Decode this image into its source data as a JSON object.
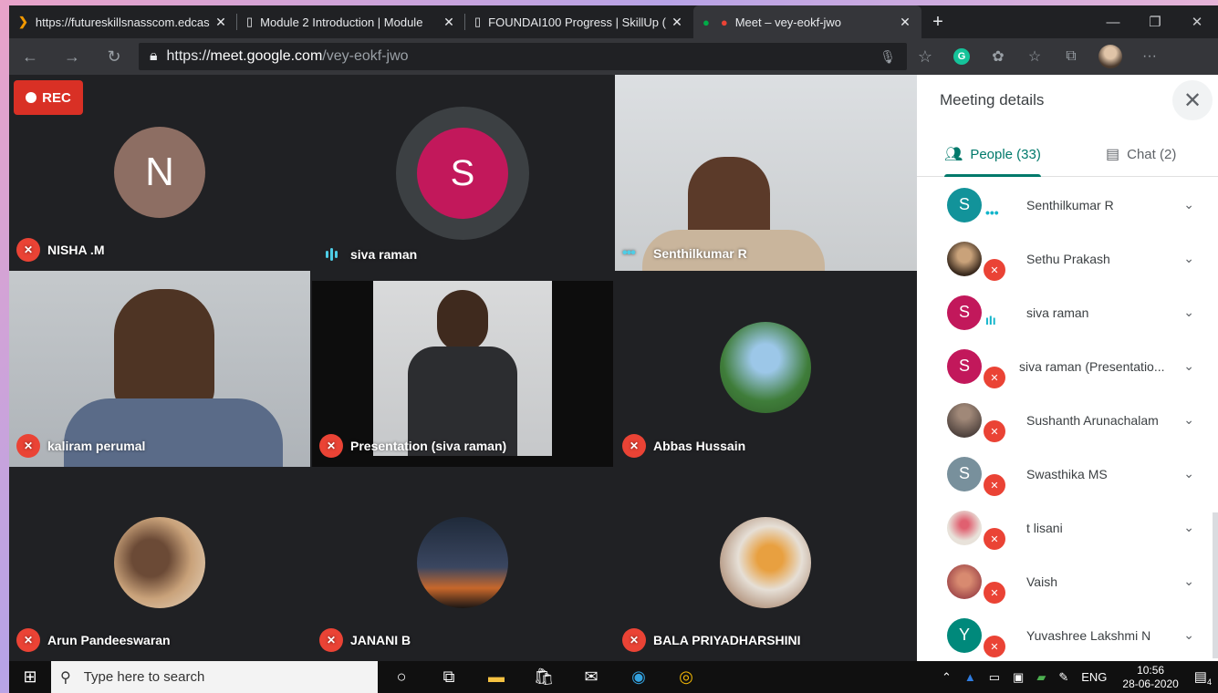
{
  "browser": {
    "tabs": [
      {
        "title": "https://futureskillsnasscom.edcas",
        "icon": "chevron-right-icon"
      },
      {
        "title": "Module 2 Introduction | Module",
        "icon": "page-icon"
      },
      {
        "title": "FOUNDAI100 Progress | SkillUp (",
        "icon": "page-icon"
      },
      {
        "title": "Meet – vey-eokf-jwo",
        "icon": "meet-icon"
      }
    ],
    "url_scheme": "https://",
    "url_host": "meet.google.com",
    "url_path": "/vey-eokf-jwo"
  },
  "meet": {
    "rec_label": "REC",
    "tiles": [
      {
        "name": "NISHA .M",
        "initial": "N",
        "status": "muted"
      },
      {
        "name": "siva raman",
        "initial": "S",
        "status": "talking"
      },
      {
        "name": "Senthilkumar R",
        "initial": "",
        "status": "dots"
      },
      {
        "name": "kaliram perumal",
        "initial": "",
        "status": "muted"
      },
      {
        "name": "Presentation (siva raman)",
        "initial": "",
        "status": "muted"
      },
      {
        "name": "Abbas Hussain",
        "initial": "",
        "status": "muted"
      },
      {
        "name": "Arun Pandeeswaran",
        "initial": "",
        "status": "muted"
      },
      {
        "name": "JANANI B",
        "initial": "",
        "status": "muted"
      },
      {
        "name": "BALA PRIYADHARSHINI",
        "initial": "",
        "status": "muted"
      }
    ]
  },
  "panel": {
    "title": "Meeting details",
    "people_tab": "People (33)",
    "chat_tab": "Chat (2)",
    "people": [
      {
        "name": "Senthilkumar R",
        "initial": "S",
        "color": "#12939a",
        "status": "dots"
      },
      {
        "name": "Sethu Prakash",
        "initial": "",
        "color": "#5a4a3a",
        "status": "muted"
      },
      {
        "name": "siva raman",
        "initial": "S",
        "color": "#c2185b",
        "status": "talking"
      },
      {
        "name": "siva raman (Presentatio...",
        "initial": "S",
        "color": "#c2185b",
        "status": "muted"
      },
      {
        "name": "Sushanth Arunachalam",
        "initial": "",
        "color": "#6b5a55",
        "status": "muted"
      },
      {
        "name": "Swasthika MS",
        "initial": "S",
        "color": "#78909c",
        "status": "muted"
      },
      {
        "name": "t lisani",
        "initial": "",
        "color": "#c9a98a",
        "status": "muted"
      },
      {
        "name": "Vaish",
        "initial": "",
        "color": "#a0484a",
        "status": "muted"
      },
      {
        "name": "Yuvashree Lakshmi N",
        "initial": "Y",
        "color": "#00897b",
        "status": "muted"
      }
    ]
  },
  "taskbar": {
    "search_placeholder": "Type here to search",
    "lang": "ENG",
    "time": "10:56",
    "date": "28-06-2020",
    "notif_count": "4"
  }
}
